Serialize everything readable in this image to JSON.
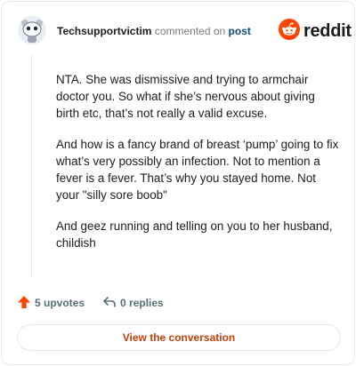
{
  "header": {
    "username": "Techsupportvictim",
    "action_text": "commented on",
    "post_link": "post",
    "brand_name": "reddit"
  },
  "comment": {
    "paragraphs": [
      "NTA. She was dismissive and trying to armchair doctor you. So what if she’s nervous about giving birth etc, that’s not really a valid excuse.",
      "And how is a fancy brand of breast ‘pump’ going to fix what’s very possibly an infection. Not to mention a fever is a fever. That’s why you stayed home. Not your \"silly sore boob\"",
      "And geez running and telling on you to her husband, childish"
    ]
  },
  "footer": {
    "upvotes_label": "5 upvotes",
    "replies_label": "0 replies",
    "cta_label": "View the conversation"
  },
  "icons": {
    "avatar": "snoo-avatar-icon",
    "brand": "reddit-logo-icon",
    "upvote": "upvote-arrow-icon",
    "reply": "reply-arrow-icon"
  },
  "colors": {
    "brand_orange": "#ff4500",
    "upvote_orange": "#ff4500",
    "link_blue": "#0f4c81",
    "cta_text": "#c2410c",
    "meta_gray": "#576f76",
    "border": "#e5e7eb"
  }
}
